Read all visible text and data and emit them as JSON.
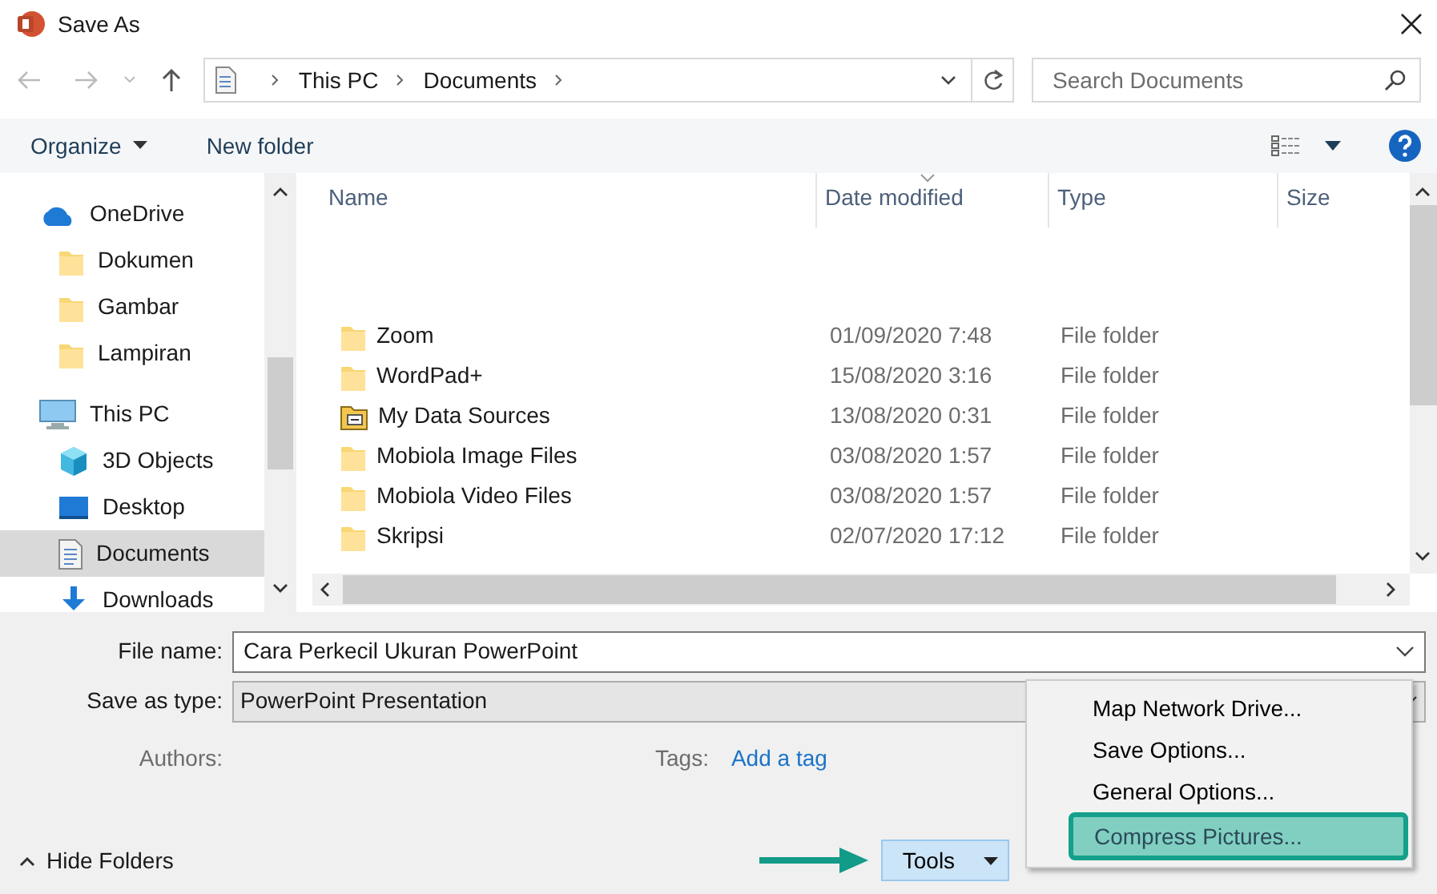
{
  "window": {
    "title": "Save As"
  },
  "address": {
    "breadcrumbs": [
      "This PC",
      "Documents"
    ]
  },
  "search": {
    "placeholder": "Search Documents"
  },
  "toolbar": {
    "organize": "Organize",
    "new_folder": "New folder"
  },
  "sidebar": {
    "items": [
      {
        "label": "OneDrive",
        "kind": "cloud",
        "selected": false,
        "children": [
          {
            "label": "Dokumen",
            "kind": "folder",
            "selected": false
          },
          {
            "label": "Gambar",
            "kind": "folder",
            "selected": false
          },
          {
            "label": "Lampiran",
            "kind": "folder",
            "selected": false
          }
        ]
      },
      {
        "label": "This PC",
        "kind": "pc",
        "selected": false,
        "children": [
          {
            "label": "3D Objects",
            "kind": "cube",
            "selected": false
          },
          {
            "label": "Desktop",
            "kind": "desktop",
            "selected": false
          },
          {
            "label": "Documents",
            "kind": "documents",
            "selected": true
          },
          {
            "label": "Downloads",
            "kind": "download",
            "selected": false
          }
        ]
      }
    ]
  },
  "table": {
    "columns": [
      {
        "label": "Name",
        "sorted": false
      },
      {
        "label": "Date modified",
        "sorted": true
      },
      {
        "label": "Type",
        "sorted": false
      },
      {
        "label": "Size",
        "sorted": false
      }
    ],
    "rows": [
      {
        "name": "Zoom",
        "date": "01/09/2020 7:48",
        "type": "File folder",
        "kind": "folder"
      },
      {
        "name": "WordPad+",
        "date": "15/08/2020 3:16",
        "type": "File folder",
        "kind": "folder"
      },
      {
        "name": "My Data Sources",
        "date": "13/08/2020 0:31",
        "type": "File folder",
        "kind": "special"
      },
      {
        "name": "Mobiola Image Files",
        "date": "03/08/2020 1:57",
        "type": "File folder",
        "kind": "folder"
      },
      {
        "name": "Mobiola Video Files",
        "date": "03/08/2020 1:57",
        "type": "File folder",
        "kind": "folder"
      },
      {
        "name": "Skripsi",
        "date": "02/07/2020 17:12",
        "type": "File folder",
        "kind": "folder"
      }
    ]
  },
  "form": {
    "file_name": {
      "label": "File name:",
      "value": "Cara Perkecil Ukuran PowerPoint"
    },
    "save_as_type": {
      "label": "Save as type:",
      "value": "PowerPoint Presentation"
    },
    "authors": {
      "label": "Authors:"
    },
    "tags": {
      "label": "Tags:",
      "link": "Add a tag"
    }
  },
  "hide_folders": "Hide Folders",
  "tools": {
    "label": "Tools",
    "menu": [
      {
        "label": "Map Network Drive...",
        "selected": false
      },
      {
        "label": "Save Options...",
        "selected": false
      },
      {
        "label": "General Options...",
        "selected": false
      },
      {
        "label": "Compress Pictures...",
        "selected": true
      }
    ]
  }
}
